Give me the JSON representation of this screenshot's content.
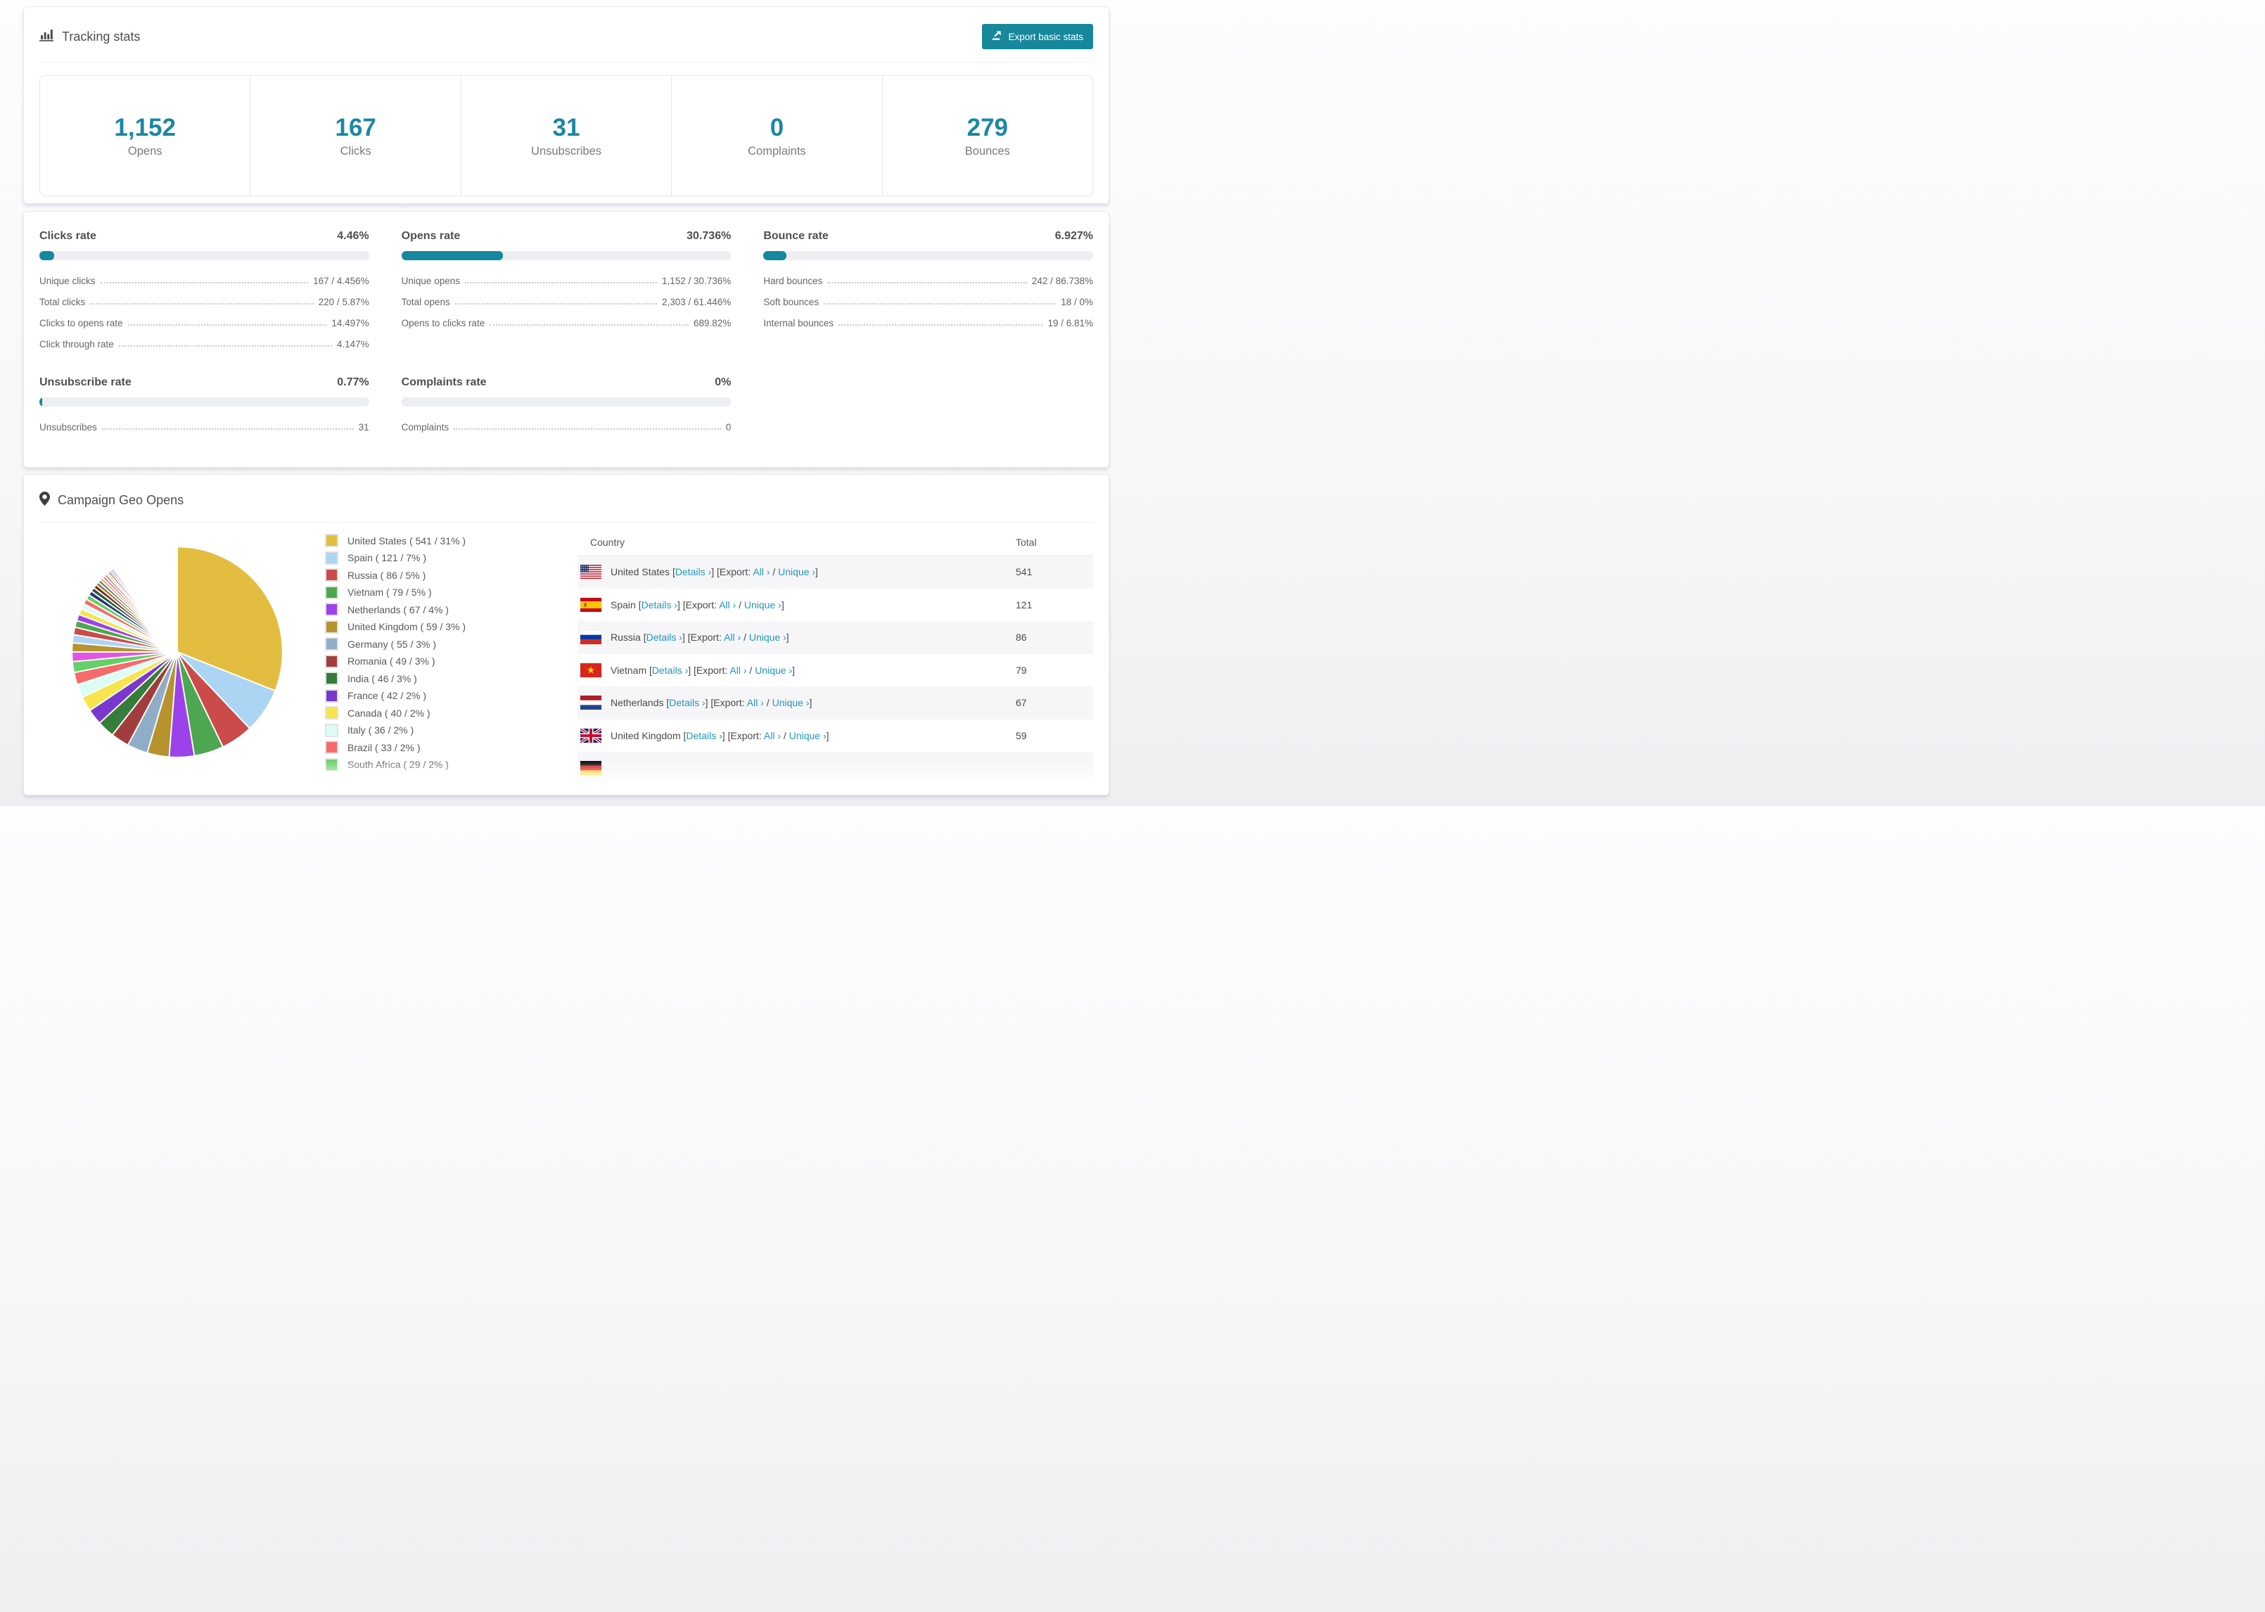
{
  "colors": {
    "accent": "#17879C",
    "stat_number": "#1B87A5",
    "link": "#2196B8",
    "bar_track": "#ECEEF1",
    "bar_fill": "#15879E"
  },
  "tracking": {
    "title": "Tracking stats",
    "export_button": "Export basic stats",
    "summary_stats": [
      {
        "value": "1,152",
        "label": "Opens"
      },
      {
        "value": "167",
        "label": "Clicks"
      },
      {
        "value": "31",
        "label": "Unsubscribes"
      },
      {
        "value": "0",
        "label": "Complaints"
      },
      {
        "value": "279",
        "label": "Bounces"
      }
    ]
  },
  "rate_panels": [
    {
      "title": "Clicks rate",
      "value": "4.46%",
      "bar_pct": 4.46,
      "rows": [
        {
          "label": "Unique clicks",
          "value": "167 / 4.456%"
        },
        {
          "label": "Total clicks",
          "value": "220 / 5.87%"
        },
        {
          "label": "Clicks to opens rate",
          "value": "14.497%"
        },
        {
          "label": "Click through rate",
          "value": "4.147%"
        }
      ]
    },
    {
      "title": "Opens rate",
      "value": "30.736%",
      "bar_pct": 30.736,
      "rows": [
        {
          "label": "Unique opens",
          "value": "1,152 / 30.736%"
        },
        {
          "label": "Total opens",
          "value": "2,303 / 61.446%"
        },
        {
          "label": "Opens to clicks rate",
          "value": "689.82%"
        }
      ]
    },
    {
      "title": "Bounce rate",
      "value": "6.927%",
      "bar_pct": 6.927,
      "rows": [
        {
          "label": "Hard bounces",
          "value": "242 / 86.738%"
        },
        {
          "label": "Soft bounces",
          "value": "18 / 0%"
        },
        {
          "label": "Internal bounces",
          "value": "19 / 6.81%"
        }
      ]
    },
    {
      "title": "Unsubscribe rate",
      "value": "0.77%",
      "bar_pct": 0.77,
      "rows": [
        {
          "label": "Unsubscribes",
          "value": "31"
        }
      ]
    },
    {
      "title": "Complaints rate",
      "value": "0%",
      "bar_pct": 0,
      "rows": [
        {
          "label": "Complaints",
          "value": "0"
        }
      ]
    }
  ],
  "geo": {
    "title": "Campaign Geo Opens",
    "table": {
      "columns": [
        "Country",
        "Total"
      ],
      "link_labels": {
        "open": "[",
        "details": "Details ›",
        "mid": "] [Export: ",
        "all": "All ›",
        "sep": " / ",
        "unique": "Unique ›",
        "close": "]"
      },
      "rows": [
        {
          "flag": "us",
          "country": "United States",
          "total": "541"
        },
        {
          "flag": "es",
          "country": "Spain",
          "total": "121"
        },
        {
          "flag": "ru",
          "country": "Russia",
          "total": "86"
        },
        {
          "flag": "vn",
          "country": "Vietnam",
          "total": "79"
        },
        {
          "flag": "nl",
          "country": "Netherlands",
          "total": "67"
        },
        {
          "flag": "gb",
          "country": "United Kingdom",
          "total": "59"
        }
      ],
      "partial_row": {
        "flag": "de"
      }
    }
  },
  "chart_data": {
    "type": "pie",
    "title": "Campaign Geo Opens",
    "legend_position": "right",
    "start_angle_deg": 0,
    "slices": [
      {
        "name": "United States",
        "value": 541,
        "pct": "31",
        "color": "#E3BD40"
      },
      {
        "name": "Spain",
        "value": 121,
        "pct": "7",
        "color": "#ABD5F2"
      },
      {
        "name": "Russia",
        "value": 86,
        "pct": "5",
        "color": "#CB4B4B"
      },
      {
        "name": "Vietnam",
        "value": 79,
        "pct": "5",
        "color": "#4CA750"
      },
      {
        "name": "Netherlands",
        "value": 67,
        "pct": "4",
        "color": "#9C42EB"
      },
      {
        "name": "United Kingdom",
        "value": 59,
        "pct": "3",
        "color": "#B6932F"
      },
      {
        "name": "Germany",
        "value": 55,
        "pct": "3",
        "color": "#90ADC8"
      },
      {
        "name": "Romania",
        "value": 49,
        "pct": "3",
        "color": "#A23D3D"
      },
      {
        "name": "India",
        "value": 46,
        "pct": "3",
        "color": "#367C3A"
      },
      {
        "name": "France",
        "value": 42,
        "pct": "2",
        "color": "#7A38CE"
      },
      {
        "name": "Canada",
        "value": 40,
        "pct": "2",
        "color": "#F8E44C"
      },
      {
        "name": "Italy",
        "value": 36,
        "pct": "2",
        "color": "#DCFDF5"
      },
      {
        "name": "Brazil",
        "value": 33,
        "pct": "2",
        "color": "#F76B6B"
      },
      {
        "name": "South Africa",
        "value": 29,
        "pct": "2",
        "color": "#65D065"
      }
    ],
    "tail_values": [
      26,
      24,
      22,
      20,
      18,
      17,
      16,
      15,
      14,
      13,
      12,
      11,
      10,
      9,
      8,
      8,
      7,
      7,
      6,
      6,
      5,
      5,
      4,
      4,
      3,
      3,
      3,
      2,
      2,
      2,
      2,
      1,
      1,
      1,
      1,
      1,
      1,
      1,
      1,
      1
    ],
    "tail_palette": [
      "#E455E4",
      "#B6932F",
      "#ABD5F2",
      "#CB4B4B",
      "#4CA750",
      "#9C42EB",
      "#F8E44C",
      "#DCFDF5",
      "#F76B6B",
      "#65D065",
      "#2E2E78",
      "#1F5E31",
      "#7D2828",
      "#8C7E22",
      "#56718E",
      "#E3BD40"
    ],
    "gap_value": 149
  }
}
